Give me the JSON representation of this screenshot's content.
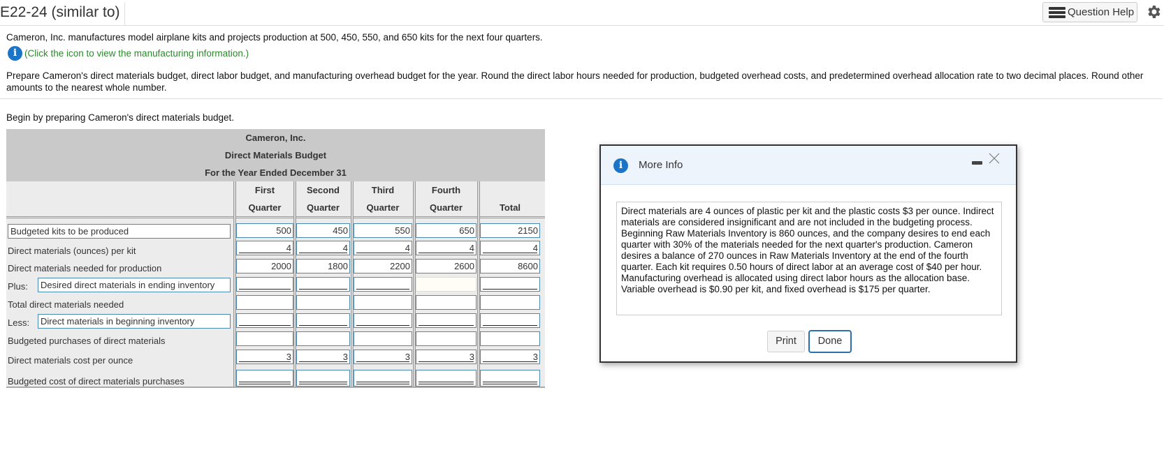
{
  "header": {
    "title": "E22-24 (similar to)",
    "question_help_label": "Question Help",
    "question_help_icon": "list-icon",
    "settings_icon": "gear-icon"
  },
  "intro": {
    "text": "Cameron, Inc. manufactures model airplane kits and projects production at 500, 450, 550, and 650 kits for the next four quarters.",
    "info_link": "(Click the icon to view the manufacturing information.)",
    "info_icon": "info-icon"
  },
  "instructions": "Prepare Cameron's direct materials budget, direct labor budget, and manufacturing overhead budget for the year. Round the direct labor hours needed for production, budgeted overhead costs, and predetermined overhead allocation rate to two decimal places. Round other amounts to the nearest whole number.",
  "begin": "Begin by preparing Cameron's direct materials budget.",
  "budget": {
    "company": "Cameron, Inc.",
    "title": "Direct Materials Budget",
    "period": "For the Year Ended December 31",
    "columns": [
      {
        "line1": "First",
        "line2": "Quarter"
      },
      {
        "line1": "Second",
        "line2": "Quarter"
      },
      {
        "line1": "Third",
        "line2": "Quarter"
      },
      {
        "line1": "Fourth",
        "line2": "Quarter"
      },
      {
        "line1": "",
        "line2": "Total"
      }
    ],
    "rows": [
      {
        "label": "Budgeted kits to be produced",
        "prefix": "",
        "label_is_input": true,
        "values": [
          "500",
          "450",
          "550",
          "650",
          "2150"
        ]
      },
      {
        "label": "Direct materials (ounces) per kit",
        "prefix": "",
        "label_is_input": false,
        "values": [
          "4",
          "4",
          "4",
          "4",
          "4"
        ]
      },
      {
        "label": "Direct materials needed for production",
        "prefix": "",
        "label_is_input": false,
        "values": [
          "2000",
          "1800",
          "2200",
          "2600",
          "8600"
        ]
      },
      {
        "label": "Desired direct materials in ending inventory",
        "prefix": "Plus:",
        "label_is_input": true,
        "values": [
          "",
          "",
          "",
          "",
          ""
        ]
      },
      {
        "label": "Total direct materials needed",
        "prefix": "",
        "label_is_input": false,
        "values": [
          "",
          "",
          "",
          "",
          ""
        ]
      },
      {
        "label": "Direct materials in beginning inventory",
        "prefix": "Less:",
        "label_is_input": true,
        "values": [
          "",
          "",
          "",
          "",
          ""
        ]
      },
      {
        "label": "Budgeted purchases of direct materials",
        "prefix": "",
        "label_is_input": false,
        "values": [
          "",
          "",
          "",
          "",
          ""
        ]
      },
      {
        "label": "Direct materials cost per ounce",
        "prefix": "",
        "label_is_input": false,
        "values": [
          "3",
          "3",
          "3",
          "3",
          "3"
        ]
      },
      {
        "label": "Budgeted cost of direct materials purchases",
        "prefix": "",
        "label_is_input": false,
        "values": [
          "",
          "",
          "",
          "",
          ""
        ]
      }
    ]
  },
  "modal": {
    "title": "More Info",
    "body": "Direct materials are 4 ounces of plastic per kit and the plastic costs $3 per ounce. Indirect materials are considered insignificant and are not included in the budgeting process. Beginning Raw Materials Inventory is 860 ounces, and the company desires to end each quarter with 30% of the materials needed for the next quarter's production. Cameron desires a balance of 270 ounces in Raw Materials Inventory at the end of the fourth quarter. Each kit requires 0.50 hours of direct labor at an average cost of $40 per hour. Manufacturing overhead is allocated using direct labor hours as the allocation base. Variable overhead is $0.90 per kit, and fixed overhead is $175 per quarter.",
    "print_label": "Print",
    "done_label": "Done"
  }
}
